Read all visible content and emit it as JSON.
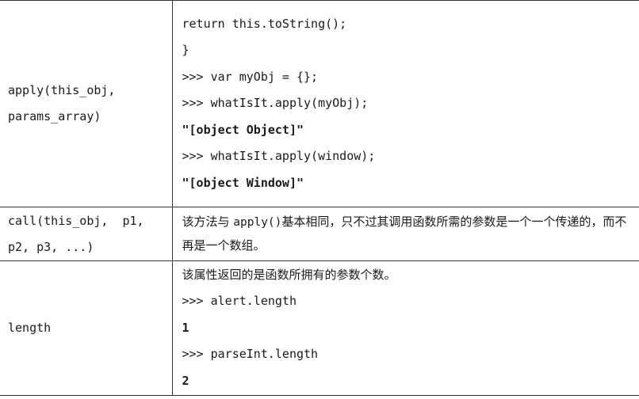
{
  "rows": [
    {
      "name_lines": [
        "apply(this_obj,",
        "params_array)"
      ],
      "lines": [
        {
          "text": "return this.toString();",
          "bold": false
        },
        {
          "text": "}",
          "bold": false
        },
        {
          "text": ">>> var myObj = {};",
          "bold": false
        },
        {
          "text": ">>> whatIsIt.apply(myObj);",
          "bold": false
        },
        {
          "text": "\"[object Object]\"",
          "bold": true
        },
        {
          "text": ">>> whatIsIt.apply(window);",
          "bold": false
        },
        {
          "text": "\"[object Window]\"",
          "bold": true
        }
      ]
    },
    {
      "name_lines": [
        "call(this_obj,  p1,",
        "p2, p3, ...)"
      ],
      "desc_part1": "该方法与 ",
      "desc_code": "apply()",
      "desc_part2": "基本相同，只不过其调用函数所需的参数是一个一个传递的，而不再是一个数组。"
    },
    {
      "name_lines": [
        "length"
      ],
      "intro": "该属性返回的是函数所拥有的参数个数。",
      "lines": [
        {
          "text": ">>> alert.length",
          "bold": false
        },
        {
          "text": "1",
          "bold": true
        },
        {
          "text": ">>> parseInt.length",
          "bold": false
        },
        {
          "text": "2",
          "bold": true
        }
      ]
    }
  ]
}
